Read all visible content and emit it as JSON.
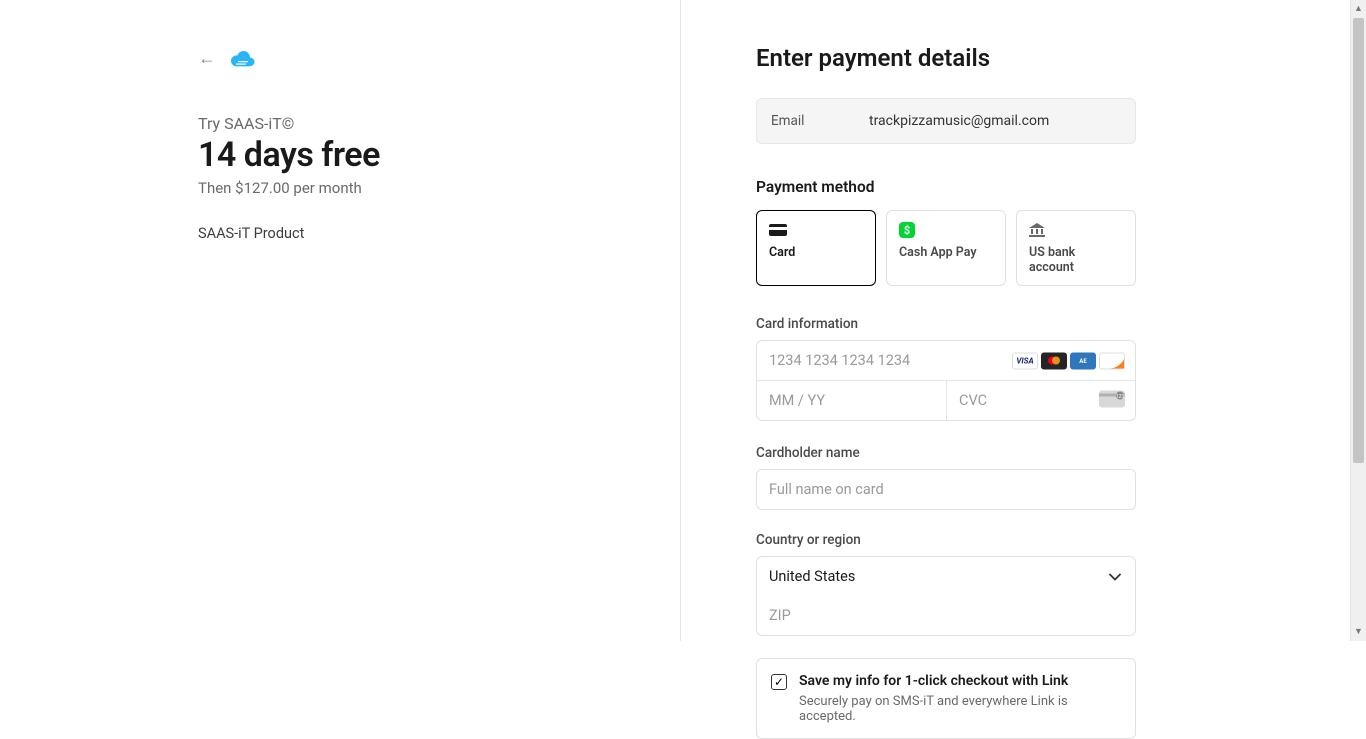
{
  "left": {
    "trial_label": "Try SAAS-iT©",
    "headline": "14 days free",
    "sub": "Then $127.00 per month",
    "product": "SAAS-iT Product"
  },
  "right": {
    "title": "Enter payment details",
    "email_label": "Email",
    "email_value": "trackpizzamusic@gmail.com",
    "payment_method_title": "Payment method",
    "methods": {
      "card": "Card",
      "cashapp": "Cash App Pay",
      "bank": "US bank account"
    },
    "card_info_label": "Card information",
    "card_number_placeholder": "1234 1234 1234 1234",
    "expiry_placeholder": "MM / YY",
    "cvc_placeholder": "CVC",
    "cardholder_label": "Cardholder name",
    "cardholder_placeholder": "Full name on card",
    "country_label": "Country or region",
    "country_value": "United States",
    "zip_placeholder": "ZIP",
    "link": {
      "title": "Save my info for 1-click checkout with Link",
      "sub": "Securely pay on SMS-iT and everywhere Link is accepted."
    }
  }
}
